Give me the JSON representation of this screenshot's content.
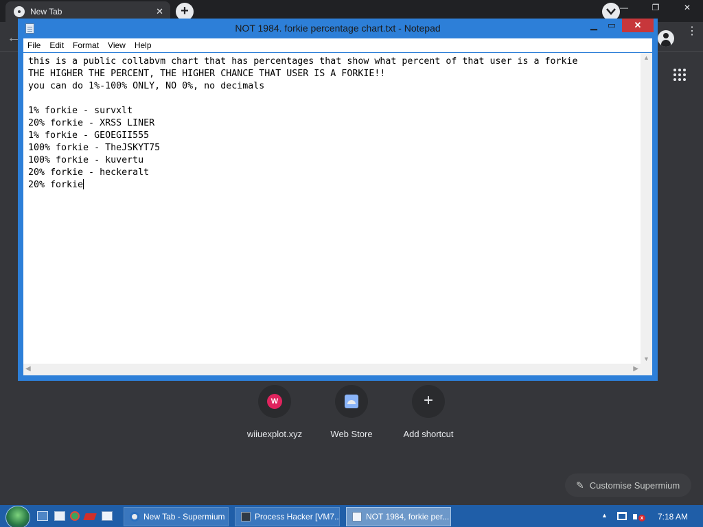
{
  "browser": {
    "tab_title": "New Tab",
    "tab_close": "✕",
    "new_tab": "+",
    "back": "←",
    "menu": "⋮",
    "window_controls": {
      "minimize": "—",
      "restore": "❐",
      "close": "✕"
    },
    "shortcuts": [
      {
        "label": "wiiuexplot.xyz",
        "icon": "W"
      },
      {
        "label": "Web Store",
        "icon": "web-store-icon"
      },
      {
        "label": "Add shortcut",
        "icon": "+"
      }
    ],
    "customise_label": "Customise Supermium",
    "customise_icon": "✎"
  },
  "notepad": {
    "title": "NOT 1984. forkie percentage chart.txt - Notepad",
    "controls": {
      "minimize": "▁",
      "maximize": "▭",
      "close": "✕"
    },
    "menu": [
      "File",
      "Edit",
      "Format",
      "View",
      "Help"
    ],
    "lines": [
      "this is a public collabvm chart that has percentages that show what percent of that user is a forkie",
      "THE HIGHER THE PERCENT, THE HIGHER CHANCE THAT USER IS A FORKIE!!",
      "you can do 1%-100% ONLY, NO 0%, no decimals",
      "",
      "1% forkie - survxlt",
      "20% forkie - XRSS LINER",
      "1% forkie - GEOEGII555",
      "100% forkie - TheJSKYT75",
      "100% forkie - kuvertu",
      "20% forkie - heckeralt",
      "20% forkie"
    ]
  },
  "taskbar": {
    "tasks": [
      {
        "label": "New Tab - Supermium",
        "active": false
      },
      {
        "label": "Process Hacker [VM7...",
        "active": false
      },
      {
        "label": "NOT 1984, forkie per...",
        "active": true
      }
    ],
    "clock": "7:18 AM",
    "tray_expand": "▲",
    "volume_mute": "x"
  }
}
